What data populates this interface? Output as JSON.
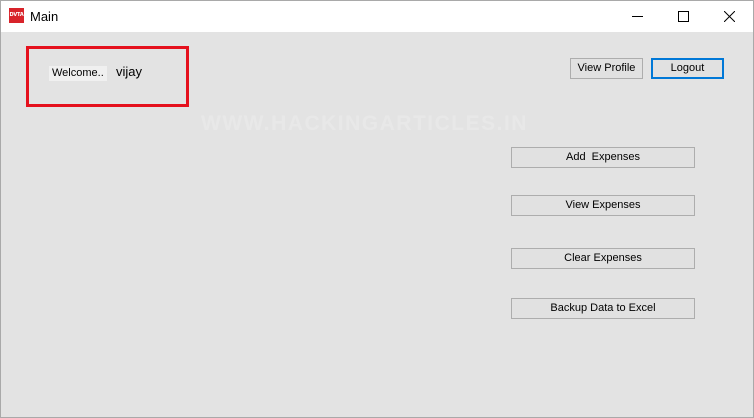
{
  "window": {
    "title": "Main",
    "icon_name": "dvta-app-icon",
    "icon_text": "DVTA",
    "controls": {
      "minimize": "minimize-icon",
      "maximize": "maximize-icon",
      "close": "close-icon"
    }
  },
  "user": {
    "welcome_label": "Welcome..",
    "username": "vijay"
  },
  "header_buttons": {
    "view_profile": "View Profile",
    "logout": "Logout"
  },
  "actions": {
    "add_expenses": "Add  Expenses",
    "view_expenses": "View Expenses",
    "clear_expenses": "Clear Expenses",
    "backup": "Backup Data to Excel"
  },
  "watermark": "WWW.HACKINGARTICLES.IN",
  "colors": {
    "highlight_box": "#e5111d",
    "focus_border": "#0078d7",
    "app_icon_bg": "#d8232a",
    "form_background": "#e3e3e3"
  }
}
